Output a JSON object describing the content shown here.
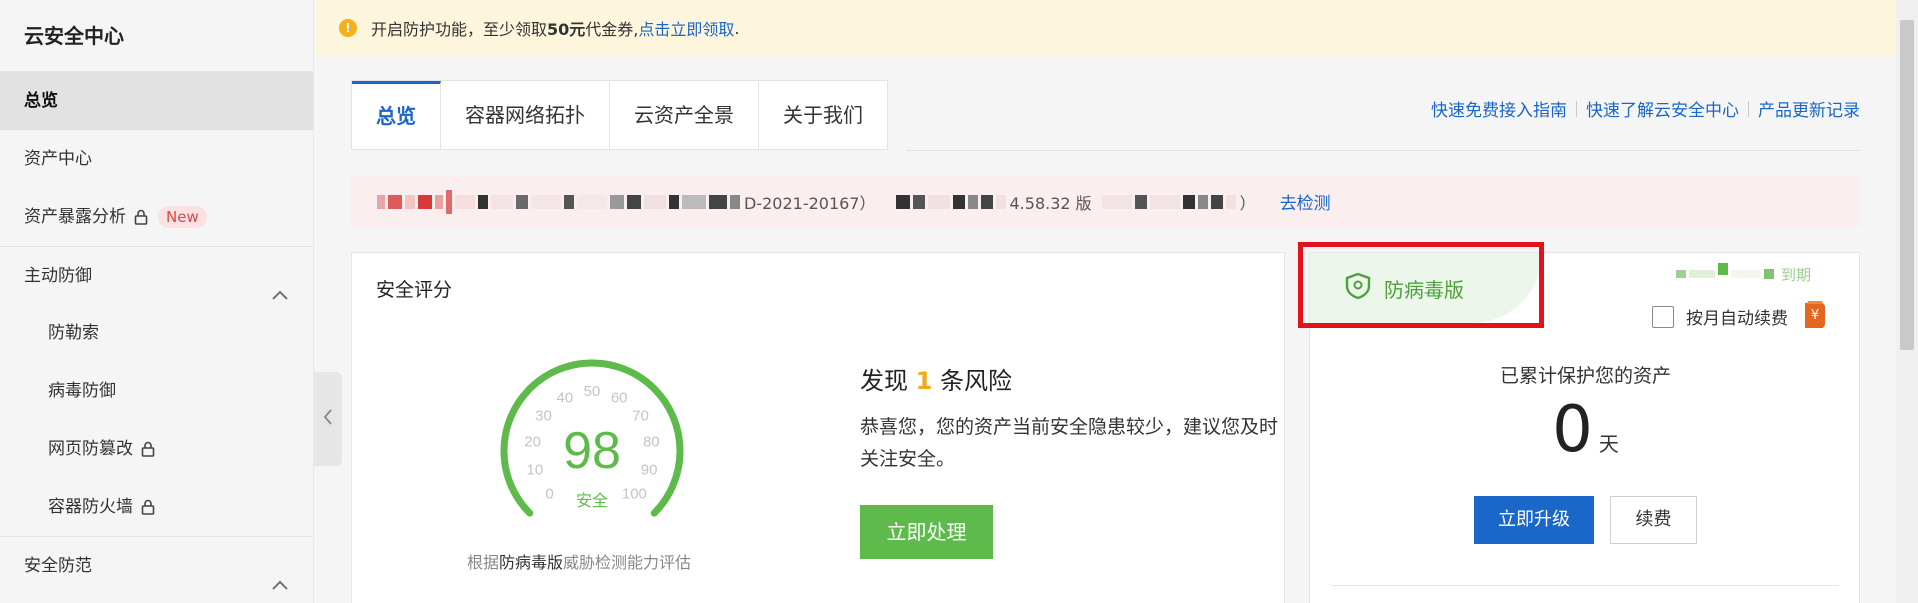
{
  "sidebar": {
    "title": "云安全中心",
    "items": [
      {
        "label": "总览"
      },
      {
        "label": "资产中心"
      },
      {
        "label": "资产暴露分析",
        "badge": "New"
      },
      {
        "label": "主动防御"
      },
      {
        "label": "防勒索"
      },
      {
        "label": "病毒防御"
      },
      {
        "label": "网页防篡改"
      },
      {
        "label": "容器防火墙"
      },
      {
        "label": "安全防范"
      }
    ]
  },
  "notice": {
    "text_before": "开启防护功能，至少领取",
    "amount": "50元",
    "text_after": "代金券,",
    "link": "点击立即领取",
    "end": "."
  },
  "tabs": [
    {
      "label": "总览"
    },
    {
      "label": "容器网络拓扑"
    },
    {
      "label": "云资产全景"
    },
    {
      "label": "关于我们"
    }
  ],
  "top_links": [
    "快速免费接入指南",
    "快速了解云安全中心",
    "产品更新记录"
  ],
  "alert": {
    "fragment1": "D-2021-20167）",
    "fragment2": "4.58.32 版",
    "fragment3": "）",
    "link": "去检测"
  },
  "score_panel": {
    "title": "安全评分",
    "score": "98",
    "score_label": "安全",
    "ticks": [
      "0",
      "10",
      "20",
      "30",
      "40",
      "50",
      "60",
      "70",
      "80",
      "90",
      "100"
    ],
    "caption_before": "根据",
    "caption_bold": "防病毒版",
    "caption_after": "威胁检测能力评估",
    "risk_prefix": "发现",
    "risk_count": "1",
    "risk_suffix": "条风险",
    "desc": "恭喜您，您的资产当前安全隐患较少，建议您及时关注安全。",
    "button": "立即处理"
  },
  "right_panel": {
    "version": "防病毒版",
    "expire_text": "到期",
    "auto_renew": "按月自动续费",
    "protect_title": "已累计保护您的资产",
    "days": "0",
    "days_unit": "天",
    "upgrade_button": "立即升级",
    "renew_button": "续费"
  },
  "colors": {
    "brand_blue": "#1a66c9",
    "safe_green": "#5fba4c",
    "highlight_red": "#e3131b",
    "risk_orange": "#f2a91d"
  }
}
